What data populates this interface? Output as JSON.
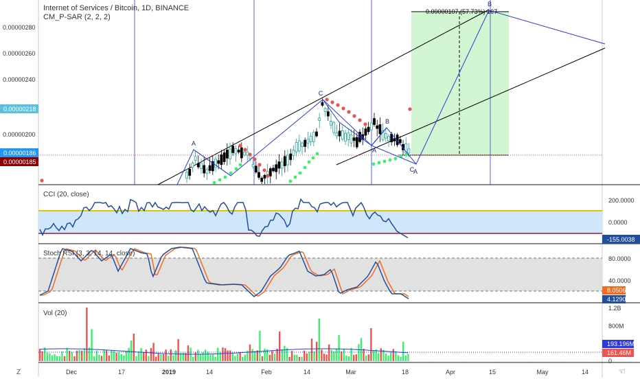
{
  "header": {
    "symbol_title": "Internet of Services / Bitcoin, 1D, BINANCE",
    "indicator_label": "CM_P-SAR (2, 2, 2)"
  },
  "price_axis": {
    "ticks": [
      "0.00000280",
      "0.00000260",
      "0.00000240",
      "0.00000220",
      "0.00000200"
    ],
    "badges": [
      {
        "label": "0.00000218",
        "color": "#5bc0de"
      },
      {
        "label": "0.00000186",
        "color": "#2196f3"
      },
      {
        "label": "0.00000185",
        "color": "#8b0000"
      }
    ]
  },
  "pattern_labels": [
    "A",
    "C",
    "A",
    "B",
    "C",
    "A",
    "B"
  ],
  "measure_label": "0.00000107 (57.73%) 107",
  "cci": {
    "label": "CCI (20, close)",
    "ticks": [
      "200.0000",
      "0.0000"
    ],
    "value_badge": "-155.0038",
    "value_color": "#1f4e9c",
    "band_upper_color": "#e6c200",
    "band_lower_color": "#9c1c2c"
  },
  "stoch": {
    "label": "Stoch RSI (3, 3, 14, 14, close)",
    "ticks": [
      "80.0000",
      "40.0000"
    ],
    "k_badge": "8.0506",
    "d_badge": "4.1290",
    "k_color": "#f26b21",
    "d_color": "#1f4e9c"
  },
  "volume": {
    "label": "Vol (20)",
    "ticks": [
      "1.2B",
      "800M",
      "0"
    ],
    "ma_badge": "193.196M",
    "last_badge": "161.46M",
    "ma_color": "#2a3ae0",
    "last_color": "#ef5350"
  },
  "time_axis": {
    "labels": [
      "Dec",
      "17",
      "2019",
      "14",
      "Feb",
      "14",
      "Mar",
      "18",
      "Apr",
      "15",
      "May",
      "14"
    ]
  },
  "corner_icons": {
    "left": "Z",
    "right": "hand-icon"
  },
  "colors": {
    "up_candle": "#26a69a",
    "down_candle": "#000000",
    "sar_up": "#3cf06e",
    "sar_down": "#ef5350",
    "pattern_line": "#2a3ae0",
    "channel_line": "#000000",
    "target_zone": "#ccf5cc"
  },
  "chart_data": {
    "type": "candlestick",
    "title": "Internet of Services / Bitcoin, 1D, BINANCE",
    "price_ylim": [
      1.74e-06,
      2.94e-06
    ],
    "close_path": [
      [
        "Dec",
        1.795e-06
      ],
      [
        "17",
        1.835e-06
      ],
      [
        "2019",
        1.86e-06
      ],
      [
        "14",
        1.905e-06
      ],
      [
        "Feb",
        1.87e-06
      ],
      [
        "14",
        2.12e-06
      ],
      [
        "Mar",
        1.99e-06
      ],
      [
        "18",
        1.86e-06
      ]
    ],
    "last_close": 1.85e-06,
    "cci": {
      "last": -155.0038,
      "upper": 100,
      "lower": -100
    },
    "stoch_rsi": {
      "k_last": 8.0506,
      "d_last": 4.129,
      "upper": 80,
      "lower": 20
    },
    "volume": {
      "ma_last": "193.196M",
      "last": "161.46M",
      "ylim_labels": [
        "0",
        "800M",
        "1.2B"
      ]
    }
  }
}
